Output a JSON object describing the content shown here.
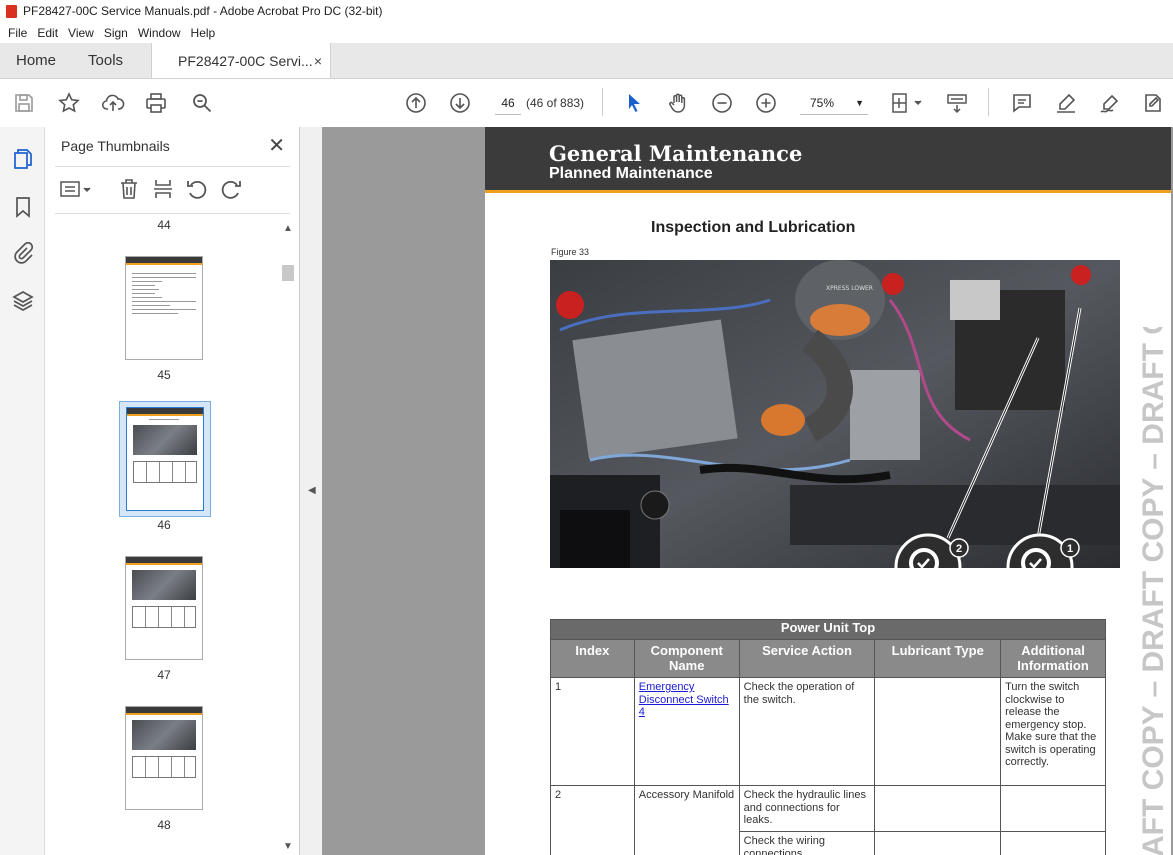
{
  "window": {
    "title": "PF28427-00C Service Manuals.pdf - Adobe Acrobat Pro DC (32-bit)"
  },
  "menu": [
    "File",
    "Edit",
    "View",
    "Sign",
    "Window",
    "Help"
  ],
  "tabs": {
    "home": "Home",
    "tools": "Tools",
    "document": "PF28427-00C Servi...",
    "close": "×"
  },
  "toolbar": {
    "page_number": "46",
    "page_count": "(46 of 883)",
    "zoom": "75%"
  },
  "thumbnails": {
    "title": "Page Thumbnails",
    "close": "✕",
    "pages": [
      "44",
      "45",
      "46",
      "47",
      "48"
    ],
    "selected_page": "46"
  },
  "document": {
    "header_title": "General Maintenance",
    "header_subtitle": "Planned Maintenance",
    "section_title": "Inspection and Lubrication",
    "figure_label": "Figure 33",
    "callouts": [
      "2",
      "1"
    ],
    "watermark": "AFT COPY – DRAFT COPY – DRAFT COPY",
    "photo_labels": {
      "brand": "XPRESS LOWER"
    },
    "table": {
      "caption": "Power Unit Top",
      "headers": [
        "Index",
        "Component Name",
        "Service Action",
        "Lubricant Type",
        "Additional Information"
      ],
      "rows": [
        {
          "index": "1",
          "component": "Emergency Disconnect Switch 4",
          "action": "Check the operation of the switch.",
          "lubricant": "",
          "info": "Turn the switch clockwise to release the emergency stop. Make sure that the switch is operating correctly."
        },
        {
          "index": "2",
          "component": "Accessory Manifold",
          "action": "Check the hydraulic lines and connections for leaks.",
          "lubricant": "",
          "info": ""
        },
        {
          "index": "",
          "component": "",
          "action": "Check the wiring connections.",
          "lubricant": "",
          "info": ""
        }
      ]
    }
  },
  "colors": {
    "accent": "#f0a020",
    "header_bg": "#3b3b3b",
    "link": "#1a1ad8"
  }
}
